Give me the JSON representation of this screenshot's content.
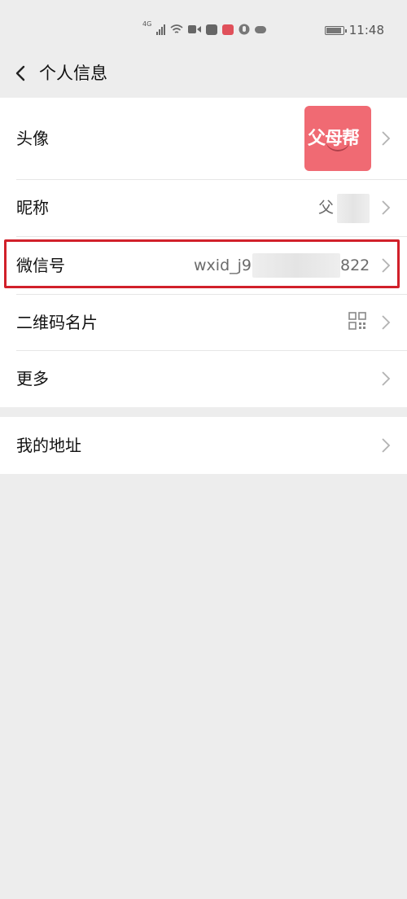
{
  "status_bar": {
    "network": "4G",
    "time": "11:48"
  },
  "nav": {
    "title": "个人信息"
  },
  "profile": {
    "avatar": {
      "label": "头像",
      "image_text": "父母帮"
    },
    "nickname": {
      "label": "昵称",
      "value": "父"
    },
    "wechat_id": {
      "label": "微信号",
      "value_prefix": "wxid_j9",
      "value_suffix": "822"
    },
    "qr_card": {
      "label": "二维码名片"
    },
    "more": {
      "label": "更多"
    }
  },
  "address": {
    "label": "我的地址"
  },
  "colors": {
    "background": "#ededed",
    "card": "#ffffff",
    "highlight_border": "#d1202a",
    "avatar_bg": "#f06a73"
  }
}
